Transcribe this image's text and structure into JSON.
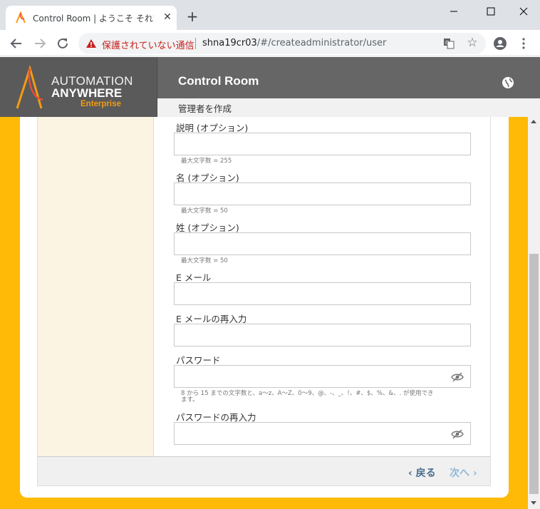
{
  "browser": {
    "tab_title": "Control Room | ようこそ それでは始めましょう",
    "new_tab_icon": "plus-icon",
    "security_label": "保護されていない通信",
    "url_host": "shna19cr03",
    "url_path": "/#/createadministrator/user"
  },
  "app": {
    "logo": {
      "line1": "AUTOMATION",
      "line2": "ANYWHERE",
      "line3": "Enterprise"
    },
    "header_title": "Control Room",
    "sub_title": "管理者を作成"
  },
  "form": {
    "fields": [
      {
        "label": "説明 (オプション)",
        "value": "",
        "hint": "最大文字数 = 255"
      },
      {
        "label": "名 (オプション)",
        "value": "",
        "hint": "最大文字数 = 50"
      },
      {
        "label": "姓 (オプション)",
        "value": "",
        "hint": "最大文字数 = 50"
      },
      {
        "label": "E メール",
        "value": ""
      },
      {
        "label": "E メールの再入力",
        "value": ""
      },
      {
        "label": "パスワード",
        "value": "",
        "hint_line1": "8 から 15 までの文字数と、a〜z、A〜Z、0〜9、@、-、_、!、#、$、%、&、. が使用でき",
        "hint_line2": "ます。"
      },
      {
        "label": "パスワードの再入力",
        "value": ""
      }
    ],
    "back_label": "‹ 戻る",
    "next_label": "次へ ›"
  },
  "colors": {
    "accent": "#ffba08",
    "header_bg": "#666666",
    "not_secure": "#c5221f",
    "logo_orange": "#f39c12"
  }
}
